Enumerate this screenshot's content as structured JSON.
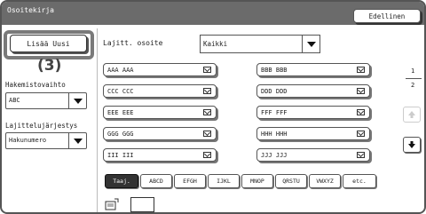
{
  "window": {
    "title": "Osoitekirja",
    "close_label": "Edellinen"
  },
  "add_new": {
    "label": "Lisää Uusi",
    "callout": "(3)"
  },
  "sidebar": {
    "directory_label": "Hakemistovaihto",
    "directory_value": "ABC",
    "sort_label": "Lajittelujärjestys",
    "sort_value": "Hakunumero"
  },
  "address_type": {
    "label": "Lajitt. osoite",
    "value": "Kaikki"
  },
  "entries": [
    [
      "AAA AAA",
      "BBB BBB"
    ],
    [
      "CCC CCC",
      "DDD DDD"
    ],
    [
      "EEE EEE",
      "FFF FFF"
    ],
    [
      "GGG GGG",
      "HHH HHH"
    ],
    [
      "III III",
      "JJJ JJJ"
    ]
  ],
  "pagination": {
    "current": "1",
    "total": "2"
  },
  "tabs": [
    "Taaj.",
    "ABCD",
    "EFGH",
    "IJKL",
    "MNOP",
    "QRSTU",
    "VWXYZ",
    "etc."
  ],
  "active_tab": "Taaj.",
  "colors": {
    "titlebar": "#6b6b6b",
    "active_tab": "#333333"
  }
}
